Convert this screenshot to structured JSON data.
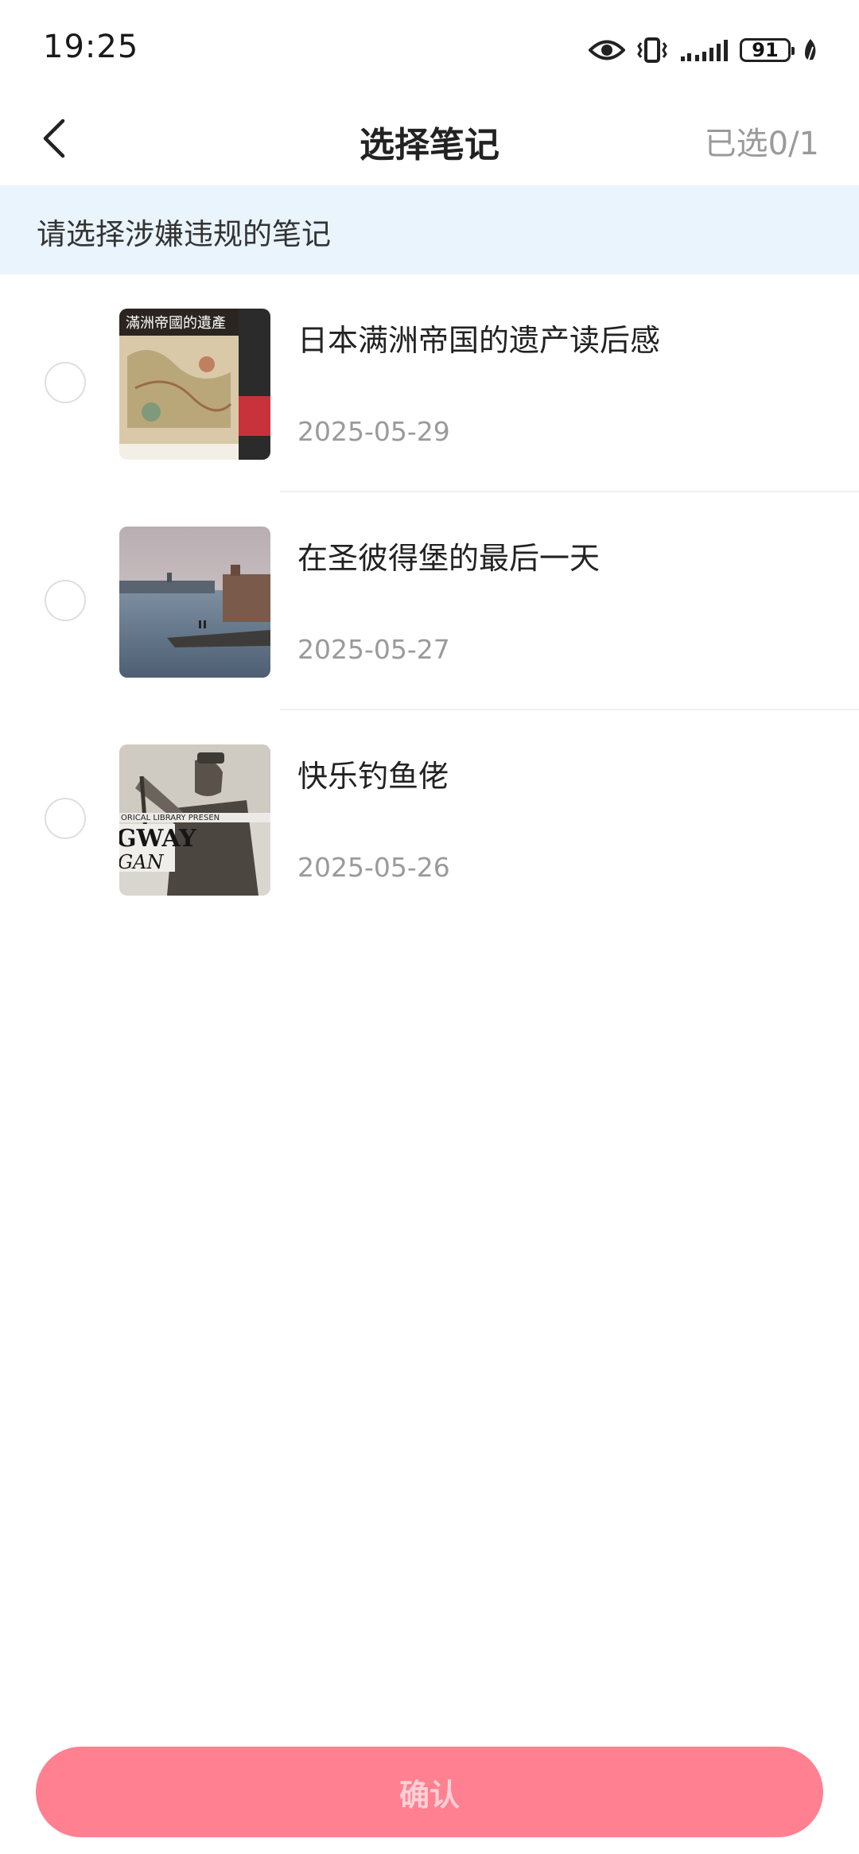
{
  "status_bar": {
    "time": "19:25",
    "battery": "91",
    "icons": [
      "eye-icon",
      "vibrate-icon",
      "signal-icon",
      "battery-icon",
      "leaf-icon"
    ]
  },
  "nav": {
    "back_icon": "chevron-left-icon",
    "title": "选择笔记",
    "selected_count": "已选0/1"
  },
  "notice": {
    "text": "请选择涉嫌违规的笔记"
  },
  "notes": [
    {
      "title": "日本满洲帝国的遗产读后感",
      "date": "2025-05-29",
      "selected": false,
      "cover_text": "滿洲帝國的遺產"
    },
    {
      "title": "在圣彼得堡的最后一天",
      "date": "2025-05-27",
      "selected": false
    },
    {
      "title": "快乐钓鱼佬",
      "date": "2025-05-26",
      "selected": false,
      "cover_text": "GWAY",
      "cover_text_2": "GAN",
      "cover_text_3": "ORICAL LIBRARY PRESEN"
    }
  ],
  "confirm": {
    "label": "确认"
  },
  "colors": {
    "accent": "#ff8090",
    "notice_bg": "#eaf4fd",
    "muted_text": "#9a9a9a"
  }
}
